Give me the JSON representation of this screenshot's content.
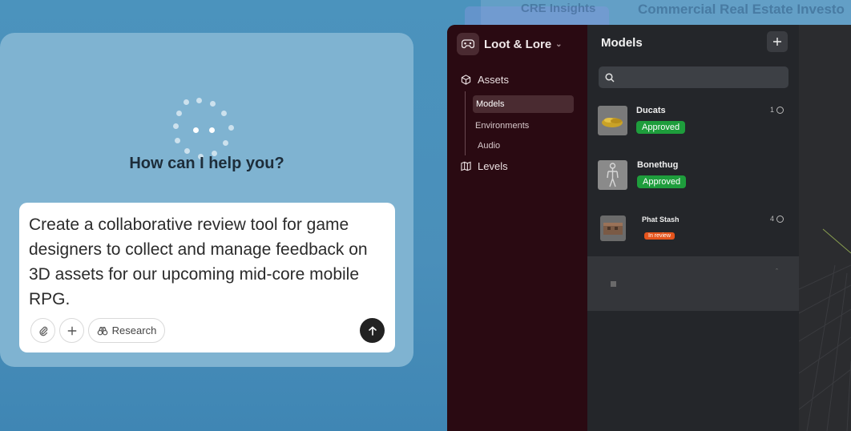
{
  "background": {
    "ghost_left_title": "CRE Insights",
    "ghost_right_title": "Commercial Real Estate Investo"
  },
  "assistant": {
    "heading": "How can I help you?",
    "prompt": "Create a collaborative review tool for game designers to collect and manage feedback on 3D assets for our upcoming mid-core mobile RPG.",
    "research_label": "Research"
  },
  "app": {
    "name": "Loot & Lore",
    "sidebar": {
      "assets_label": "Assets",
      "sub_items": [
        "Models",
        "Environments",
        "Audio"
      ],
      "levels_label": "Levels"
    },
    "panel": {
      "title": "Models",
      "items": [
        {
          "name": "Ducats",
          "status": "Approved",
          "comments": "1"
        },
        {
          "name": "Bonethug",
          "status": "Approved",
          "comments": ""
        },
        {
          "name": "Phat Stash",
          "status": "In review",
          "comments": "4"
        }
      ]
    },
    "colors": {
      "sidebar": "#2a0a12",
      "approved": "#1e9d3c",
      "in_review": "#e5541c"
    }
  }
}
